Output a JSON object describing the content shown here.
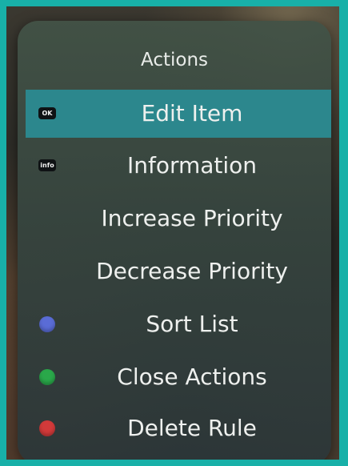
{
  "menu": {
    "title": "Actions",
    "items": [
      {
        "label": "Edit Item",
        "key": "OK",
        "selected": true
      },
      {
        "label": "Information",
        "key": "info"
      },
      {
        "label": "Increase Priority"
      },
      {
        "label": "Decrease Priority"
      },
      {
        "label": "Sort List",
        "key_color": "#5a6cd6"
      },
      {
        "label": "Close Actions",
        "key_color": "#2aa84a"
      },
      {
        "label": "Delete Rule",
        "key_color": "#d23a3a"
      }
    ]
  },
  "colors": {
    "frame": "#18b0a8",
    "selected_row": "#2c878d",
    "blue_key": "#5a6cd6",
    "green_key": "#2aa84a",
    "red_key": "#d23a3a"
  }
}
